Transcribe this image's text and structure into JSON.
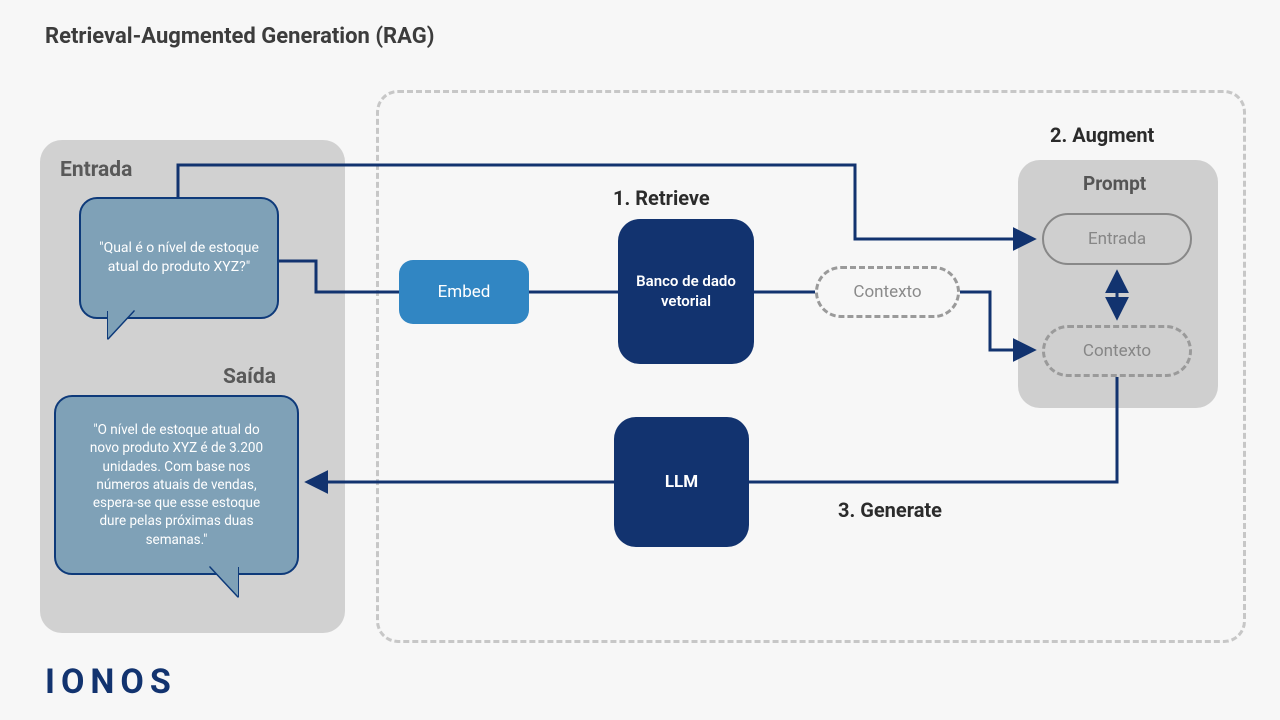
{
  "title": "Retrieval-Augmented Generation (RAG)",
  "io_panel": {
    "entrada_label": "Entrada",
    "saida_label": "Saída",
    "input_text": "\"Qual é o nível de estoque atual do produto XYZ?\"",
    "output_text": "\"O nível de estoque atual do novo produto XYZ é de 3.200 unidades. Com base nos números atuais de vendas, espera-se que esse estoque dure pelas próximas duas semanas.\""
  },
  "steps": {
    "retrieve": "1. Retrieve",
    "augment": "2. Augment",
    "generate": "3. Generate"
  },
  "nodes": {
    "embed": "Embed",
    "vector_db": "Banco de dado vetorial",
    "context": "Contexto",
    "llm": "LLM"
  },
  "augment_panel": {
    "prompt_label": "Prompt",
    "entrada": "Entrada",
    "contexto": "Contexto"
  },
  "logo": "IONOS"
}
